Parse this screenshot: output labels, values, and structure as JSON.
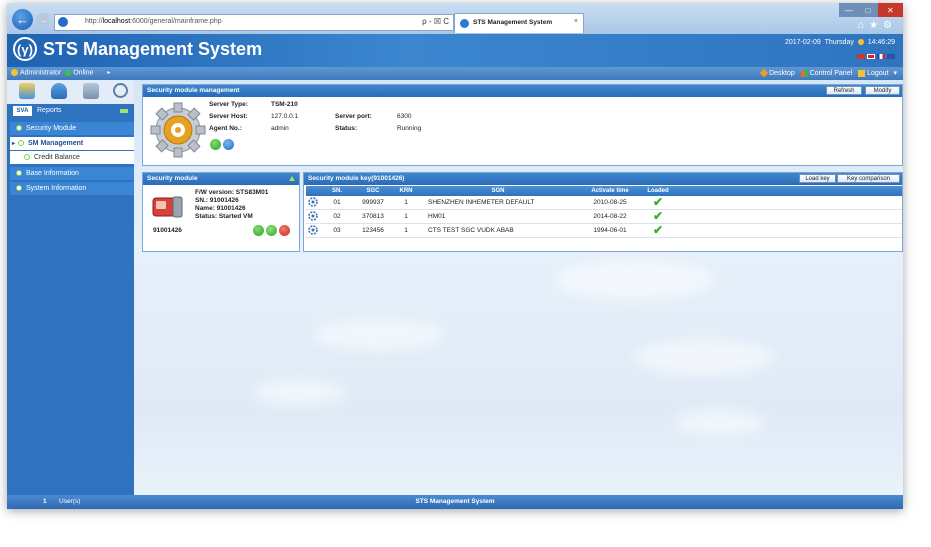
{
  "browser": {
    "url_prefix": "http://",
    "url_host": "localhost",
    "url_rest": ":6000/general/mainframe.php",
    "address_controls": "ρ - ☒ C",
    "tab_title": "STS Management System",
    "tab_close": "×"
  },
  "app": {
    "title": "STS Management System",
    "logo_glyph": "(γ)",
    "date": "2017-02-09",
    "weekday": "Thursday",
    "time": "14:46:29"
  },
  "userbar": {
    "user": "Administrator",
    "status": "Online",
    "desktop": "Desktop",
    "control_panel": "Control Panel",
    "logout": "Logout"
  },
  "sidebar": {
    "tab_sva": "SVA",
    "tab_reports": "Reports",
    "items": [
      {
        "label": "Security Module"
      },
      {
        "label": "SM Management"
      },
      {
        "label": "Credit Balance"
      },
      {
        "label": "Base Information"
      },
      {
        "label": "System Information"
      }
    ]
  },
  "smm_panel": {
    "title": "Security module management",
    "refresh": "Refresh",
    "modify": "Modify",
    "server_type_label": "Server Type:",
    "server_type": "TSM-210",
    "server_host_label": "Server Host:",
    "server_host": "127.0.0.1",
    "server_port_label": "Server port:",
    "server_port": "6300",
    "agent_no_label": "Agent No.:",
    "agent_no": "admin",
    "status_label": "Status:",
    "status": "Running"
  },
  "sm_panel": {
    "title": "Security module",
    "fw_version": "F/W version: STS83M01",
    "sn": "SN.: 91001426",
    "name": "Name: 91001426",
    "status": "Status: Started VM",
    "id": "91001426"
  },
  "smk_panel": {
    "title": "Security module key(91001426)",
    "load_key": "Load key",
    "key_comparison": "Key comparison",
    "columns": [
      "SN.",
      "SGC",
      "KRN",
      "SGN",
      "Activate time",
      "Loaded"
    ],
    "rows": [
      {
        "sn": "01",
        "sgc": "999937",
        "krn": "1",
        "sgn": "SHENZHEN INHEMETER DEFAULT",
        "activate": "2010-08-25"
      },
      {
        "sn": "02",
        "sgc": "370813",
        "krn": "1",
        "sgn": "HM01",
        "activate": "2014-08-22"
      },
      {
        "sn": "03",
        "sgc": "123456",
        "krn": "1",
        "sgn": "CTS TEST SGC VUDK ABAB",
        "activate": "1994-06-01"
      }
    ]
  },
  "statusbar": {
    "count": "1",
    "users_label": "User(s)",
    "title": "STS Management System"
  },
  "colors": {
    "header_blue": "#2f74bf",
    "check_green": "#3cae2a",
    "accent_orange": "#e8a021"
  }
}
